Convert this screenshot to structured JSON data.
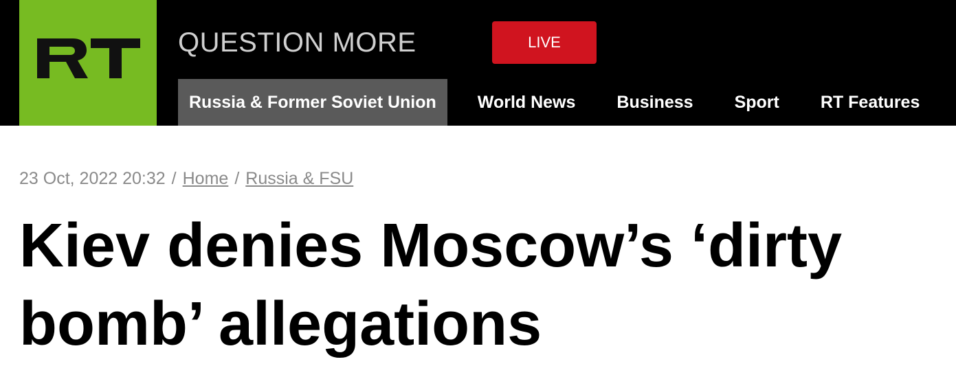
{
  "header": {
    "logo_text": "RT",
    "tagline": "QUESTION MORE",
    "live_label": "LIVE",
    "colors": {
      "background": "#000000",
      "logo_green": "#77bb22",
      "live_red": "#d0141f",
      "active_nav": "#5a5a5a"
    }
  },
  "nav": {
    "items": [
      {
        "label": "Russia & Former Soviet Union",
        "active": true
      },
      {
        "label": "World News",
        "active": false
      },
      {
        "label": "Business",
        "active": false
      },
      {
        "label": "Sport",
        "active": false
      },
      {
        "label": "RT Features",
        "active": false
      }
    ]
  },
  "article": {
    "timestamp": "23 Oct, 2022 20:32",
    "separator": "/",
    "breadcrumbs": [
      {
        "label": "Home"
      },
      {
        "label": "Russia & FSU"
      }
    ],
    "headline": "Kiev denies Moscow’s ‘dirty bomb’ allegations"
  }
}
